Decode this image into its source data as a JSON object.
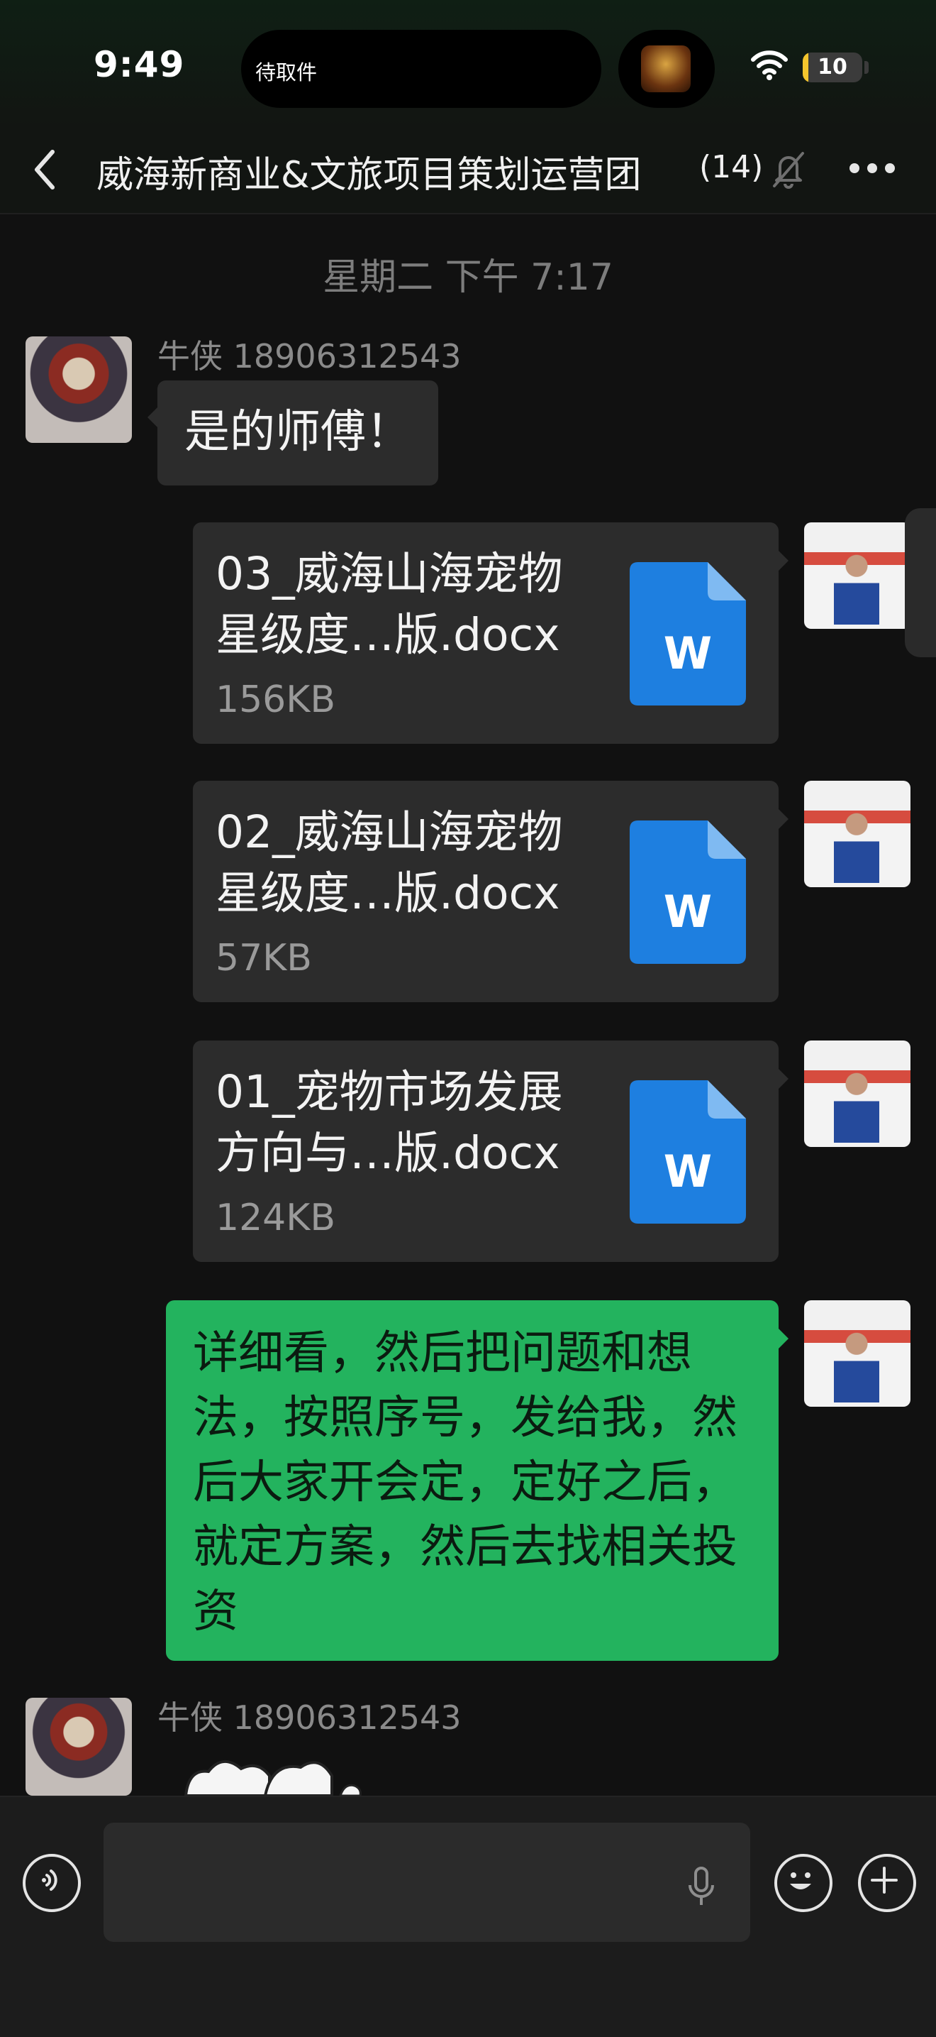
{
  "status_bar": {
    "time": "9:49",
    "island_text": "待取件",
    "battery_level": "10",
    "battery_fraction": 0.1,
    "wifi_icon": "wifi-icon"
  },
  "nav": {
    "title": "威海新商业&文旅项目策划运营团",
    "member_count": "(14)",
    "back_icon": "chevron-left-icon",
    "mute_icon": "bell-slash-icon",
    "more_icon": "more-icon"
  },
  "chat": {
    "timestamp": "星期二 下午 7:17",
    "messages": [
      {
        "sender": "牛侠 18906312543",
        "text": "是的师傅！"
      },
      {
        "file_name": "03_威海山海宠物星级度…版.docx",
        "file_size": "156KB"
      },
      {
        "file_name": "02_威海山海宠物星级度…版.docx",
        "file_size": "57KB"
      },
      {
        "file_name": "01_宠物市场发展方向与…版.docx",
        "file_size": "124KB"
      },
      {
        "text": "详细看，然后把问题和想法，按照序号，发给我，然后大家开会定，定好之后，就定方案，然后去找相关投资"
      },
      {
        "sender": "牛侠 18906312543"
      }
    ],
    "file_icon_letter": "W",
    "colors": {
      "outgoing": "#23b35e",
      "incoming": "#2c2c2c",
      "file_icon": "#1e7fe0"
    }
  },
  "input_bar": {
    "placeholder": "",
    "voice_icon": "voice-icon",
    "mic_icon": "mic-icon",
    "emoji_icon": "emoji-icon",
    "plus_icon": "plus-icon"
  }
}
